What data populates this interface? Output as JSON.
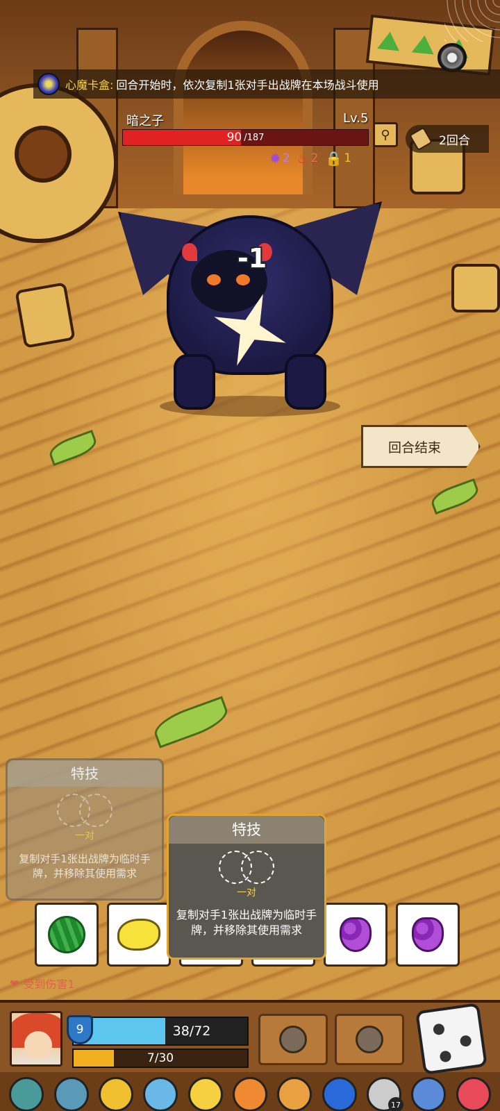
{
  "relic_banner": {
    "name": "心魔卡盒:",
    "description": "回合开始时，依次复制1张对手出战牌在本场战斗使用"
  },
  "enemy": {
    "name": "暗之子",
    "level": "Lv.5",
    "hp_current": "90",
    "hp_max": "/187",
    "hp_fraction": 0.481,
    "statuses": [
      {
        "icon": "purple-splat-icon",
        "value": "2",
        "color": "#a04ad8"
      },
      {
        "icon": "fire-icon",
        "value": "2",
        "color": "#e03a2a"
      },
      {
        "icon": "lock-icon",
        "value": "1",
        "color": "#f0c030"
      }
    ]
  },
  "round": {
    "label": "2回合"
  },
  "damage_popup": "-1",
  "end_turn": {
    "label": "回合结束"
  },
  "skill_cards": [
    {
      "header": "特技",
      "pair_label": "一对",
      "description": "复制对手1张出战牌为临时手牌，并移除其使用需求"
    },
    {
      "header": "特技",
      "pair_label": "一对",
      "description": "复制对手1张出战牌为临时手牌，并移除其使用需求"
    }
  ],
  "hand_cards": [
    {
      "icon": "watermelon-icon"
    },
    {
      "icon": "lemon-icon"
    },
    {
      "icon": "card-hidden"
    },
    {
      "icon": "card-hidden"
    },
    {
      "icon": "grape-icon"
    },
    {
      "icon": "grape-icon"
    }
  ],
  "damage_hint": "受到伤害1",
  "player": {
    "shield": "9",
    "hp": "38/72",
    "hp_fraction": 0.528,
    "xp": "7/30",
    "xp_fraction": 0.233
  },
  "relics": [
    {
      "icon": "blade-icon"
    },
    {
      "icon": "clock-icon"
    },
    {
      "icon": "sun-medal-icon"
    },
    {
      "icon": "ring-icon"
    },
    {
      "icon": "crown-icon"
    },
    {
      "icon": "glove-icon"
    },
    {
      "icon": "fruit-bowl-icon"
    },
    {
      "icon": "blue-flame-icon"
    },
    {
      "icon": "yin-yang-icon",
      "badge": "17"
    },
    {
      "icon": "fish-icon"
    },
    {
      "icon": "card-box-icon"
    }
  ],
  "colors": {
    "hp_enemy": "#e02222",
    "hp_player": "#5cc6ee",
    "xp": "#f0b020",
    "accent_gold": "#f5d24a"
  }
}
